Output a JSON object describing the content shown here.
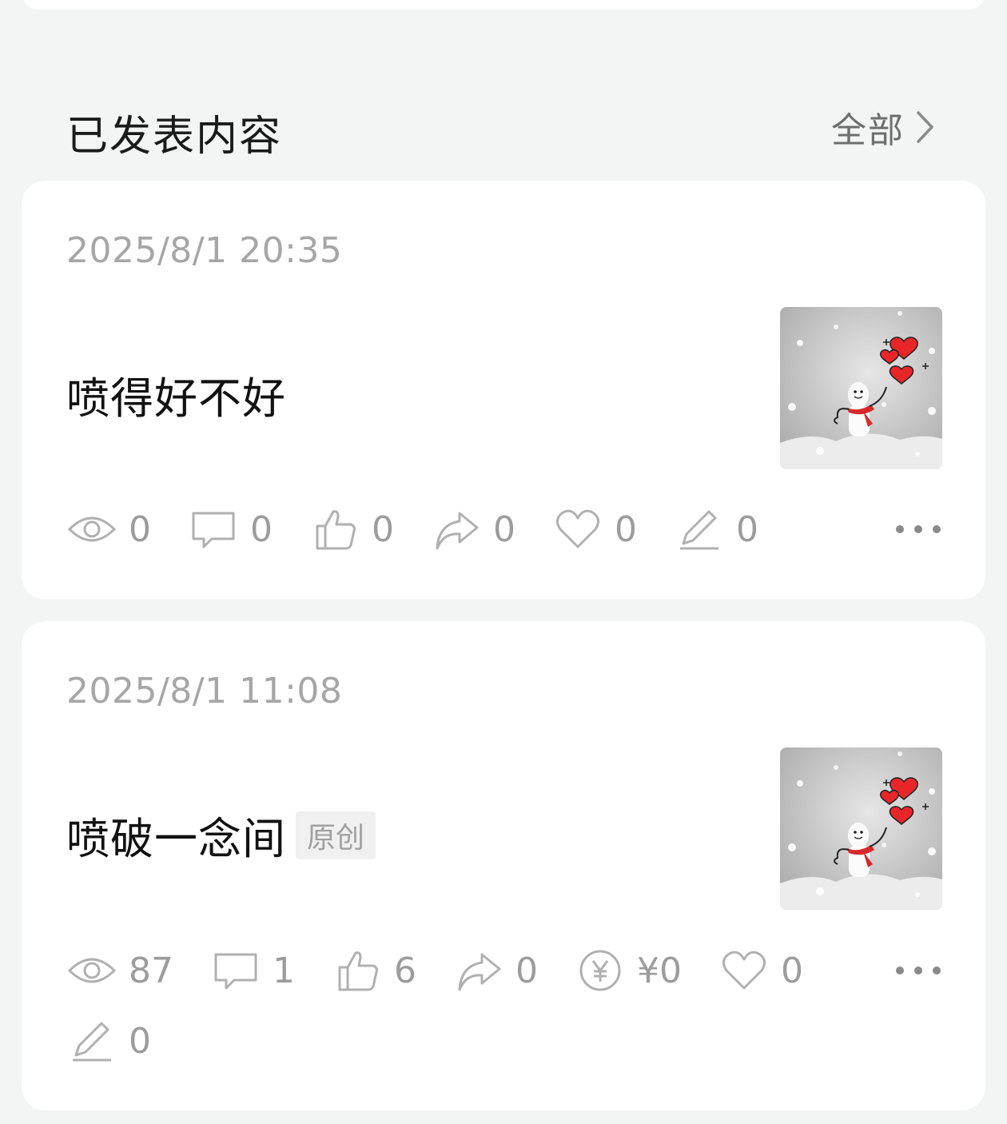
{
  "section": {
    "title": "已发表内容",
    "all_label": "全部"
  },
  "posts": [
    {
      "date": "2025/8/1 20:35",
      "title": "喷得好不好",
      "tag": "",
      "thumbnail": "snowman-hearts-image",
      "stats": {
        "views": "0",
        "comments": "0",
        "likes": "0",
        "shares": "0",
        "favorites": "0",
        "edits": "0"
      }
    },
    {
      "date": "2025/8/1 11:08",
      "title": "喷破一念间",
      "tag": "原创",
      "thumbnail": "snowman-hearts-image",
      "stats": {
        "views": "87",
        "comments": "1",
        "likes": "6",
        "shares": "0",
        "earnings": "¥0",
        "favorites": "0",
        "edits": "0"
      }
    }
  ],
  "colors": {
    "background": "#f3f4f4",
    "card": "#ffffff",
    "muted_text": "#a6a6a6",
    "icon": "#b0b0b0",
    "heart_red": "#e8262a",
    "scarf_red": "#d8282a"
  }
}
